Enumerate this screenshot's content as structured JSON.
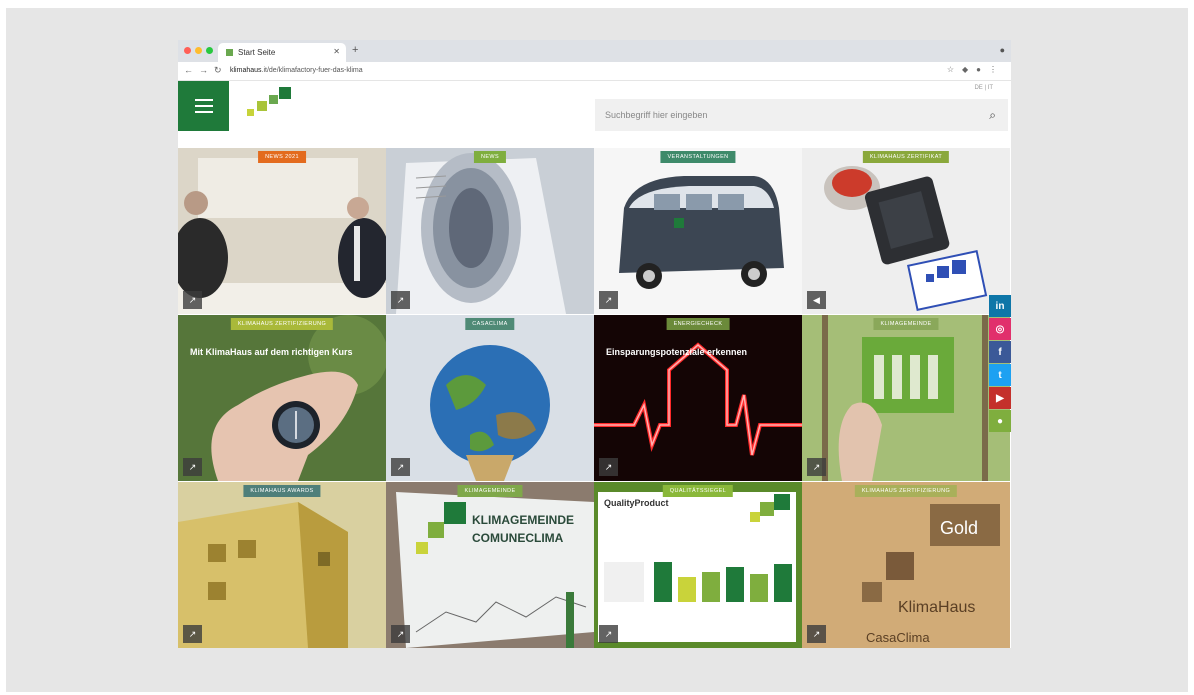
{
  "browser": {
    "tab_title": "Start Seite",
    "url_domain": "klimahaus",
    "url_rest": ".it/de/klimafactory-fuer-das-klima",
    "lang_switch": "DE | IT"
  },
  "site": {
    "search_placeholder": "Suchbegriff hier eingeben"
  },
  "tiles": [
    {
      "badge": "NEWS 2021",
      "badge_color": "#e36b1e",
      "title": ""
    },
    {
      "badge": "NEWS",
      "badge_color": "#7fae3e",
      "title": ""
    },
    {
      "badge": "VERANSTALTUNGEN",
      "badge_color": "#3e8a6a",
      "title": ""
    },
    {
      "badge": "KLIMAHAUS ZERTIFIKAT",
      "badge_color": "#8aa83b",
      "title": ""
    },
    {
      "badge": "KLIMAHAUS ZERTIFIZIERUNG",
      "badge_color": "#a9b93a",
      "title": "Mit KlimaHaus auf dem richtigen Kurs"
    },
    {
      "badge": "CASACLIMA",
      "badge_color": "#4f8a76",
      "title": ""
    },
    {
      "badge": "ENERGIECHECK",
      "badge_color": "#6b8a3a",
      "title": "Einsparungspotenziale erkennen"
    },
    {
      "badge": "KLIMAGEMEINDE",
      "badge_color": "#8aa85a",
      "title": ""
    },
    {
      "badge": "KLIMAHAUS AWARDS",
      "badge_color": "#4f7f7a",
      "title": ""
    },
    {
      "badge": "KLIMAGEMEINDE",
      "badge_color": "#7fa84a",
      "title": ""
    },
    {
      "badge": "QUALITÄTSSIEGEL",
      "badge_color": "#8ab83a",
      "title": ""
    },
    {
      "badge": "KLIMAHAUS ZERTIFIZIERUNG",
      "badge_color": "#a9b05a",
      "title": ""
    }
  ],
  "tile_texts": {
    "klimagemeinde_sign": "KLIMAGEMEINDE",
    "comuneclima_sign": "COMUNECLIMA",
    "quality_product": "QualityProduct",
    "gold": "Gold",
    "klimahaus_wood": "KlimaHaus",
    "casaclima_wood": "CasaClima"
  },
  "social": [
    {
      "icon": "linkedin-icon",
      "glyph": "in",
      "color": "#0e76a8"
    },
    {
      "icon": "instagram-icon",
      "glyph": "◎",
      "color": "#e1306c"
    },
    {
      "icon": "facebook-icon",
      "glyph": "f",
      "color": "#3b5998"
    },
    {
      "icon": "twitter-icon",
      "glyph": "t",
      "color": "#1da1f2"
    },
    {
      "icon": "youtube-icon",
      "glyph": "▶",
      "color": "#c4302b"
    },
    {
      "icon": "chat-icon",
      "glyph": "●",
      "color": "#7fae3e"
    }
  ]
}
